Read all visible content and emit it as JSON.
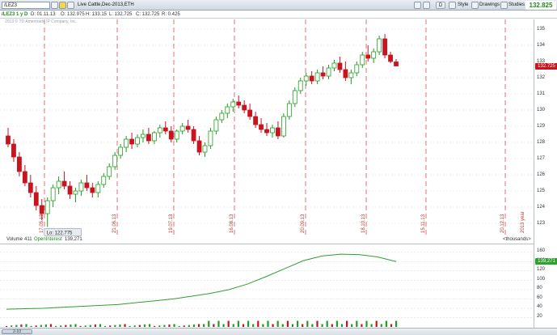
{
  "toolbar": {
    "symbol": "/LEZ3",
    "description": "Live Cattle,Dec-2013,ETH",
    "d_button": "D",
    "style_label": "Style",
    "drawings_label": "Drawings",
    "studies_label": "Studies",
    "last_price": "132.825"
  },
  "infobar": {
    "period": "/LEZ3 1 y D",
    "date": "D: 01.11.13",
    "open": "O: 132.975",
    "high": "H: 133.15",
    "low": "L: 132.725",
    "close": "C: 132.725",
    "range": "R: 0.425"
  },
  "copyright": "2013 © TD Ameritrade IP Company, Inc.",
  "price_axis": {
    "labels": [
      "135",
      "134",
      "133",
      "132",
      "131",
      "130",
      "129",
      "128",
      "127",
      "126",
      "125",
      "124",
      "123"
    ],
    "current_tag": "132.725"
  },
  "low_marker": "Lo: 122.775",
  "date_markers": [
    "17.05.13",
    "21.06.13",
    "19.07.13",
    "16.08.13",
    "20.09.13",
    "18.10.13",
    "15.11.13",
    "20.12.13",
    "2013 year"
  ],
  "volume_panel": {
    "volume_label": "Volume",
    "volume_value": "411",
    "oi_label": "OpenInterest",
    "oi_value": "139,271",
    "units": "<thousands>",
    "axis_labels": [
      "160",
      "140",
      "120",
      "100",
      "80",
      "60",
      "40",
      "20"
    ],
    "oi_tag": "139,271"
  },
  "scrollbar": {
    "label": "2-10"
  },
  "colors": {
    "up": "#1f9e1f",
    "down": "#c8141e",
    "grid": "#d9dde2",
    "marker": "#e05050",
    "oi": "#2ea02e",
    "volume_up": "#1f9e1f",
    "volume_down": "#c8141e"
  },
  "chart_data": {
    "type": "candlestick",
    "title": "Live Cattle,Dec-2013,ETH",
    "x_range": [
      "2013-05",
      "2013-12"
    ],
    "ylim": [
      122.5,
      135.3
    ],
    "price_series": [
      [
        128.4,
        128.9,
        127.7,
        127.9
      ],
      [
        127.9,
        128.2,
        126.8,
        127.1
      ],
      [
        127.1,
        127.4,
        125.9,
        126.2
      ],
      [
        126.2,
        126.6,
        125.3,
        125.5
      ],
      [
        125.5,
        126.0,
        124.6,
        124.9
      ],
      [
        124.9,
        125.3,
        123.8,
        124.1
      ],
      [
        124.1,
        124.5,
        123.2,
        123.6
      ],
      [
        123.6,
        124.6,
        122.78,
        124.4
      ],
      [
        124.4,
        125.4,
        124.0,
        125.2
      ],
      [
        125.2,
        125.9,
        124.8,
        125.6
      ],
      [
        125.6,
        126.2,
        125.1,
        125.3
      ],
      [
        125.3,
        125.6,
        124.5,
        124.8
      ],
      [
        124.8,
        125.2,
        124.3,
        125.0
      ],
      [
        125.0,
        125.7,
        124.7,
        125.5
      ],
      [
        125.5,
        126.0,
        125.0,
        125.2
      ],
      [
        125.2,
        125.5,
        124.6,
        124.9
      ],
      [
        124.9,
        125.6,
        124.6,
        125.4
      ],
      [
        125.4,
        126.1,
        125.2,
        125.9
      ],
      [
        125.9,
        126.7,
        125.7,
        126.5
      ],
      [
        126.5,
        127.4,
        126.3,
        127.2
      ],
      [
        127.2,
        127.9,
        127.0,
        127.7
      ],
      [
        127.7,
        128.4,
        127.4,
        128.2
      ],
      [
        128.2,
        128.6,
        127.6,
        127.9
      ],
      [
        127.9,
        128.5,
        127.7,
        128.3
      ],
      [
        128.3,
        128.8,
        128.0,
        128.5
      ],
      [
        128.5,
        128.9,
        127.9,
        128.1
      ],
      [
        128.1,
        128.7,
        127.9,
        128.6
      ],
      [
        128.6,
        129.1,
        128.3,
        128.9
      ],
      [
        128.9,
        129.3,
        128.5,
        128.7
      ],
      [
        128.7,
        129.0,
        128.0,
        128.2
      ],
      [
        128.2,
        128.8,
        128.0,
        128.7
      ],
      [
        128.7,
        129.2,
        128.5,
        129.0
      ],
      [
        129.0,
        129.4,
        128.6,
        128.8
      ],
      [
        128.8,
        129.0,
        127.9,
        128.1
      ],
      [
        128.1,
        128.4,
        127.2,
        127.4
      ],
      [
        127.4,
        128.0,
        127.1,
        127.8
      ],
      [
        127.8,
        128.9,
        127.6,
        128.7
      ],
      [
        128.7,
        129.6,
        128.5,
        129.4
      ],
      [
        129.4,
        130.0,
        129.2,
        129.8
      ],
      [
        129.8,
        130.4,
        129.5,
        130.2
      ],
      [
        130.2,
        130.7,
        129.9,
        130.5
      ],
      [
        130.5,
        130.9,
        130.1,
        130.3
      ],
      [
        130.3,
        130.6,
        129.8,
        130.0
      ],
      [
        130.0,
        130.4,
        129.4,
        129.6
      ],
      [
        129.6,
        129.9,
        128.9,
        129.1
      ],
      [
        129.1,
        129.5,
        128.6,
        128.8
      ],
      [
        128.8,
        129.2,
        128.4,
        128.6
      ],
      [
        128.6,
        129.1,
        128.3,
        128.9
      ],
      [
        128.9,
        129.3,
        128.2,
        128.4
      ],
      [
        128.4,
        129.8,
        128.3,
        129.6
      ],
      [
        129.6,
        130.6,
        129.4,
        130.4
      ],
      [
        130.4,
        131.4,
        130.2,
        131.2
      ],
      [
        131.2,
        132.0,
        131.0,
        131.8
      ],
      [
        131.8,
        132.3,
        131.5,
        132.1
      ],
      [
        132.1,
        132.4,
        131.6,
        131.8
      ],
      [
        131.8,
        132.5,
        131.6,
        132.3
      ],
      [
        132.3,
        132.7,
        131.9,
        132.1
      ],
      [
        132.1,
        132.8,
        131.9,
        132.6
      ],
      [
        132.6,
        133.1,
        132.4,
        132.9
      ],
      [
        132.9,
        133.3,
        132.3,
        132.5
      ],
      [
        132.5,
        133.0,
        131.8,
        132.0
      ],
      [
        132.0,
        132.5,
        131.6,
        132.3
      ],
      [
        132.3,
        133.0,
        132.1,
        132.8
      ],
      [
        132.8,
        133.6,
        132.6,
        133.4
      ],
      [
        133.4,
        134.0,
        133.0,
        133.2
      ],
      [
        133.2,
        133.8,
        132.9,
        133.6
      ],
      [
        133.6,
        134.6,
        133.4,
        134.4
      ],
      [
        134.4,
        134.7,
        133.2,
        133.4
      ],
      [
        133.4,
        133.6,
        132.9,
        133.0
      ],
      [
        132.975,
        133.15,
        132.725,
        132.725
      ]
    ],
    "open_interest": [
      38,
      39,
      40,
      42,
      44,
      46,
      48,
      52,
      56,
      60,
      66,
      72,
      80,
      92,
      108,
      125,
      142,
      152,
      156,
      155,
      150,
      140
    ],
    "volume_axis_range": [
      0,
      170
    ]
  }
}
